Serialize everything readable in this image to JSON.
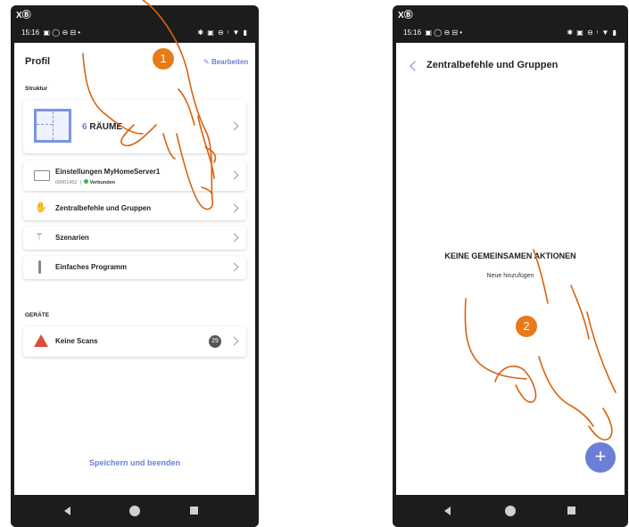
{
  "left_phone": {
    "status": {
      "time": "15:16",
      "top_icon": "XⒷ",
      "left_icons": "▣ ◯ ⊖ ⊟ •",
      "right_icons": "✱ ▣ ⊖ ᵎ ▼ ▮"
    },
    "header": {
      "title": "Profil",
      "edit_label": "Bearbeiten"
    },
    "sections": {
      "struktur": "Struktur",
      "geraete": "GERÄTE"
    },
    "rooms": {
      "count": "6",
      "label": "RÄUME"
    },
    "server": {
      "name": "Einstellungen MyHomeServer1",
      "id": "00001452",
      "separator": "|",
      "state": "Verbunden"
    },
    "menu": [
      {
        "label": "Zentralbefehle und Gruppen",
        "icon": "hand-icon"
      },
      {
        "label": "Szenarien",
        "icon": "wand-icon"
      },
      {
        "label": "Einfaches Programm",
        "icon": "thermometer-icon"
      }
    ],
    "device": {
      "label": "Keine Scans",
      "count": "29",
      "icon": "warning-icon"
    },
    "save_label": "Speichern und beenden",
    "step": "1"
  },
  "right_phone": {
    "status": {
      "time": "15:16",
      "top_icon": "XⒷ",
      "left_icons": "▣ ◯ ⊖ ⊟ •",
      "right_icons": "✱ ▣ ⊖ ᵎ ▼ ▮"
    },
    "header": {
      "title": "Zentralbefehle und Gruppen"
    },
    "empty": {
      "title": "KEINE GEMEINSAMEN AKTIONEN",
      "subtitle": "Neue hinzufügen"
    },
    "fab_label": "+",
    "step": "2"
  },
  "colors": {
    "accent": "#6a7fd6",
    "step_orange": "#e87a18",
    "hand_stroke": "#d9620f",
    "connected": "#3bb54a",
    "warning": "#e04a3a"
  }
}
